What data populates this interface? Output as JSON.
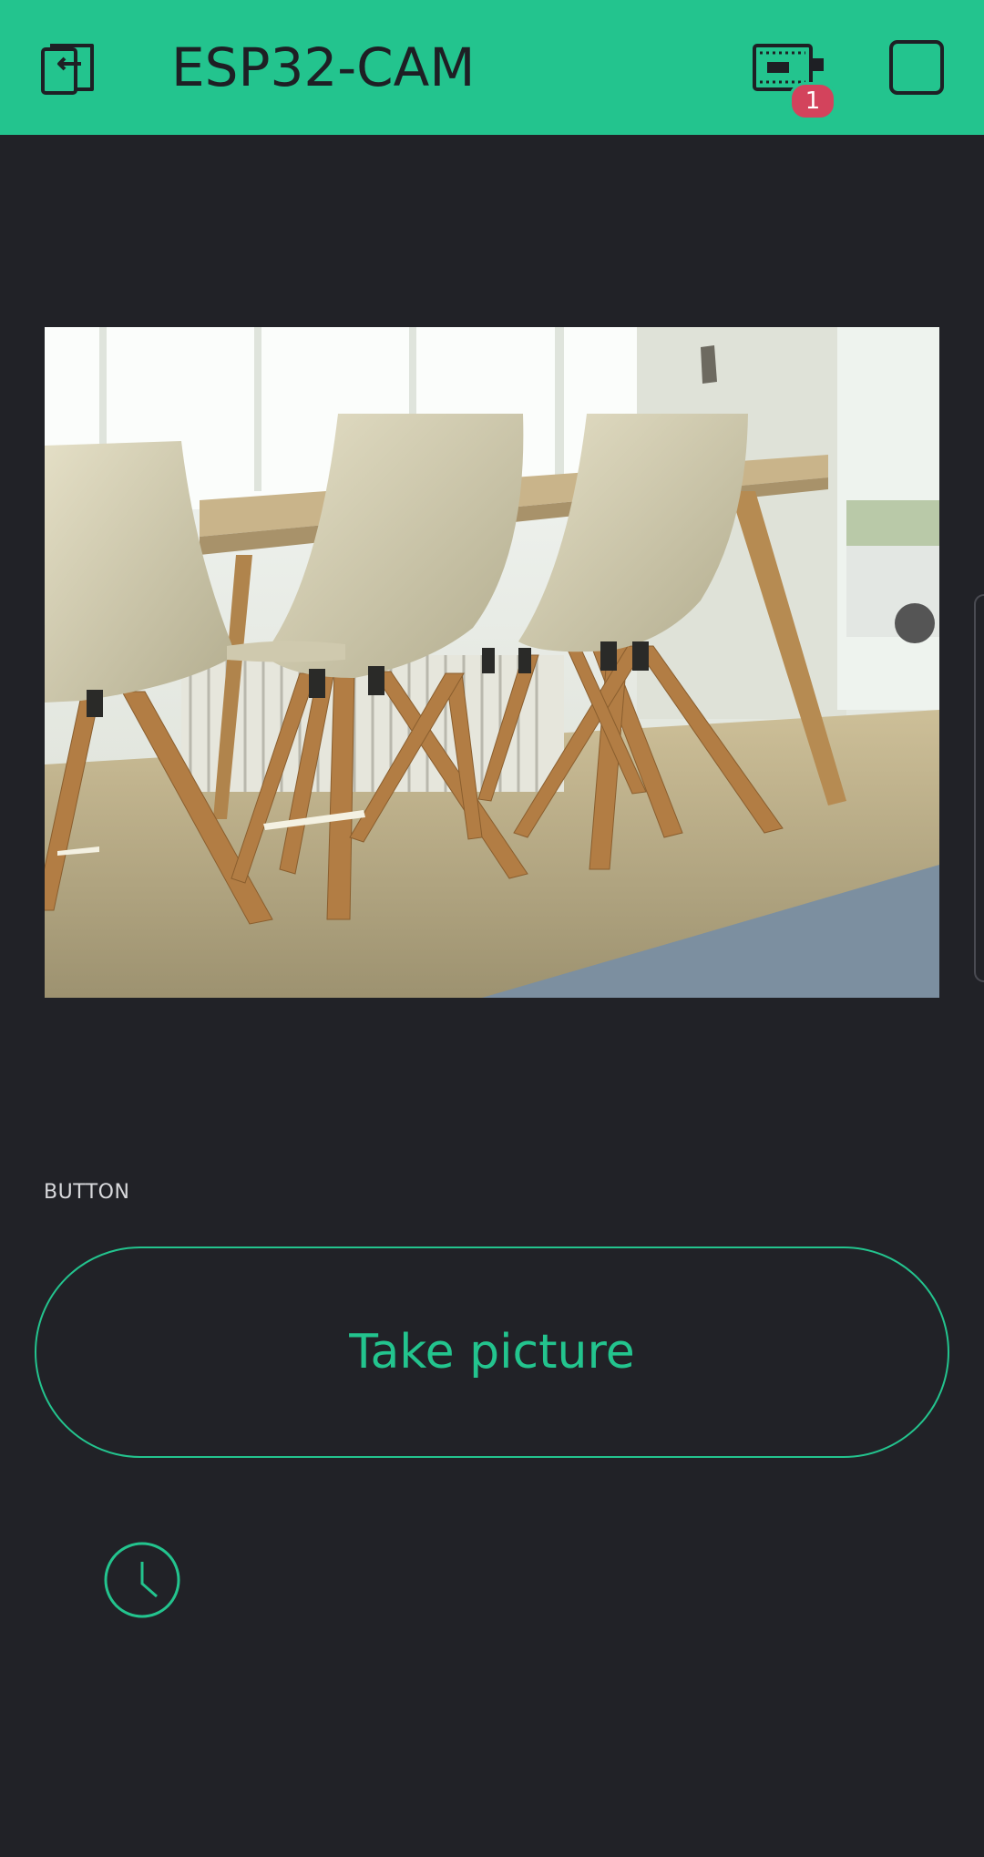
{
  "app": {
    "title": "ESP32-CAM",
    "accent_color": "#23c48e",
    "background_color": "#212227"
  },
  "header": {
    "back_icon": "exit-icon",
    "device_icon": "board-icon",
    "notification_count": "1",
    "badge_color": "#d3435c",
    "square_icon": "square-stop-icon"
  },
  "video": {
    "content": "camera-still-image"
  },
  "button_widget": {
    "section_label": "BUTTON",
    "label": "Take picture"
  },
  "timer": {
    "icon": "clock-icon"
  }
}
